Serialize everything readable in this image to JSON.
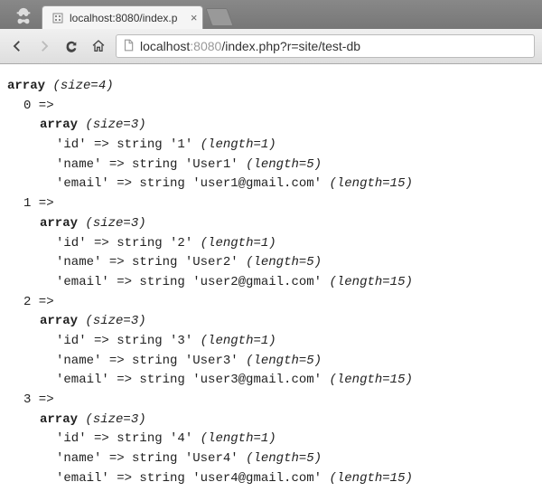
{
  "browser": {
    "tab_title": "localhost:8080/index.p",
    "url_host": "localhost",
    "url_port": ":8080",
    "url_path": "/index.php?r=site/test-db"
  },
  "dump": {
    "outer_prefix": "array ",
    "outer_meta": "(size=4)",
    "arrow": " => ",
    "inner_prefix": "array ",
    "inner_meta": "(size=3)",
    "type_label": "string ",
    "rows": [
      {
        "index": "0",
        "fields": [
          {
            "key": "'id'",
            "value": "'1'",
            "len": "(length=1)"
          },
          {
            "key": "'name'",
            "value": "'User1'",
            "len": "(length=5)"
          },
          {
            "key": "'email'",
            "value": "'user1@gmail.com'",
            "len": "(length=15)"
          }
        ]
      },
      {
        "index": "1",
        "fields": [
          {
            "key": "'id'",
            "value": "'2'",
            "len": "(length=1)"
          },
          {
            "key": "'name'",
            "value": "'User2'",
            "len": "(length=5)"
          },
          {
            "key": "'email'",
            "value": "'user2@gmail.com'",
            "len": "(length=15)"
          }
        ]
      },
      {
        "index": "2",
        "fields": [
          {
            "key": "'id'",
            "value": "'3'",
            "len": "(length=1)"
          },
          {
            "key": "'name'",
            "value": "'User3'",
            "len": "(length=5)"
          },
          {
            "key": "'email'",
            "value": "'user3@gmail.com'",
            "len": "(length=15)"
          }
        ]
      },
      {
        "index": "3",
        "fields": [
          {
            "key": "'id'",
            "value": "'4'",
            "len": "(length=1)"
          },
          {
            "key": "'name'",
            "value": "'User4'",
            "len": "(length=5)"
          },
          {
            "key": "'email'",
            "value": "'user4@gmail.com'",
            "len": "(length=15)"
          }
        ]
      }
    ]
  }
}
